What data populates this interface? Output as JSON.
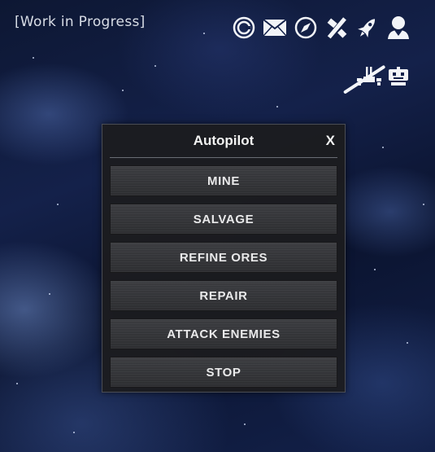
{
  "header": {
    "title": "[Work in Progress]",
    "icons": [
      "copyright-circle-icon",
      "mail-icon",
      "compass-icon",
      "tools-icon",
      "rocket-icon",
      "user-icon"
    ]
  },
  "subbar": {
    "icons": [
      "structure-icon",
      "robot-icon"
    ]
  },
  "panel": {
    "title": "Autopilot",
    "close_label": "X",
    "buttons": [
      {
        "label": "MINE"
      },
      {
        "label": "SALVAGE"
      },
      {
        "label": "REFINE ORES"
      },
      {
        "label": "REPAIR"
      },
      {
        "label": "ATTACK ENEMIES"
      },
      {
        "label": "STOP"
      }
    ]
  },
  "colors": {
    "icon": "#f2f4f8",
    "panel_bg": "#1c1c1e",
    "button_bg": "#333438",
    "text": "#e9e9ea"
  }
}
